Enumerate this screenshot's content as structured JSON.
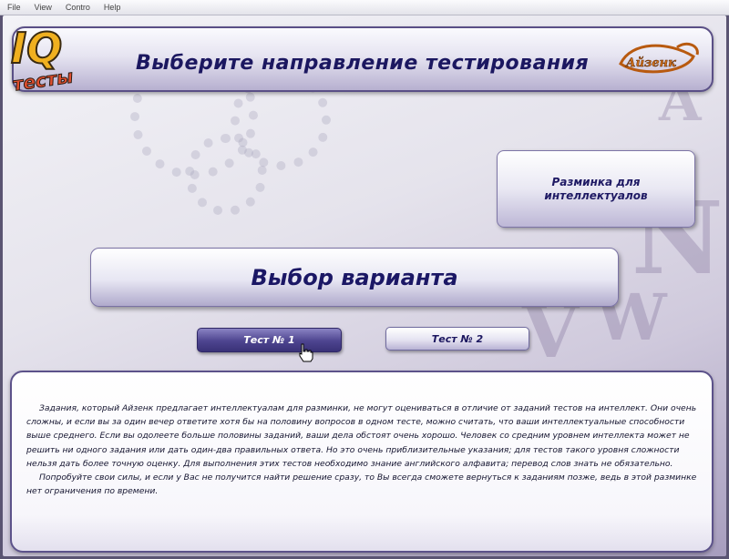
{
  "menu": {
    "items": [
      "File",
      "View",
      "Contro",
      "Help"
    ]
  },
  "header": {
    "title": "Выберите направление тестирования",
    "logo_left_text": "IQ",
    "logo_left_sub": "тесты",
    "logo_right_text": "Айзенк"
  },
  "buttons": {
    "warmup_label": "Разминка для интеллектуалов"
  },
  "variant": {
    "title": "Выбор варианта",
    "tabs": [
      {
        "label": "Тест № 1",
        "selected": true
      },
      {
        "label": "Тест № 2",
        "selected": false
      }
    ]
  },
  "description": {
    "paragraphs": [
      "Задания, который Айзенк предлагает интеллектуалам для разминки, не могут оцениваться в отличие от заданий тестов на интеллект. Они очень сложны, и если вы за один вечер ответите хотя бы на половину вопросов в одном тесте, можно считать, что ваши интеллектуальные способности выше среднего. Если вы одолеете больше половины заданий, ваши дела обстоят очень хорошо. Человек со средним уровнем интеллекта может не решить ни одного задания или дать один-два правильных ответа. Но это очень приблизительные указания; для тестов такого уровня сложности нельзя дать более точную оценку. Для выполнения этих тестов необходимо знание английского алфавита; перевод слов знать не обязательно.",
      "Попробуйте свои силы, и если у Вас не получится найти решение сразу, то Вы всегда сможете вернуться к заданиям позже, ведь в этой разминке нет ограничения по времени."
    ]
  },
  "colors": {
    "accent_dark": "#1b1760",
    "tab_active": "#4d448f",
    "border": "#5a4f86"
  }
}
